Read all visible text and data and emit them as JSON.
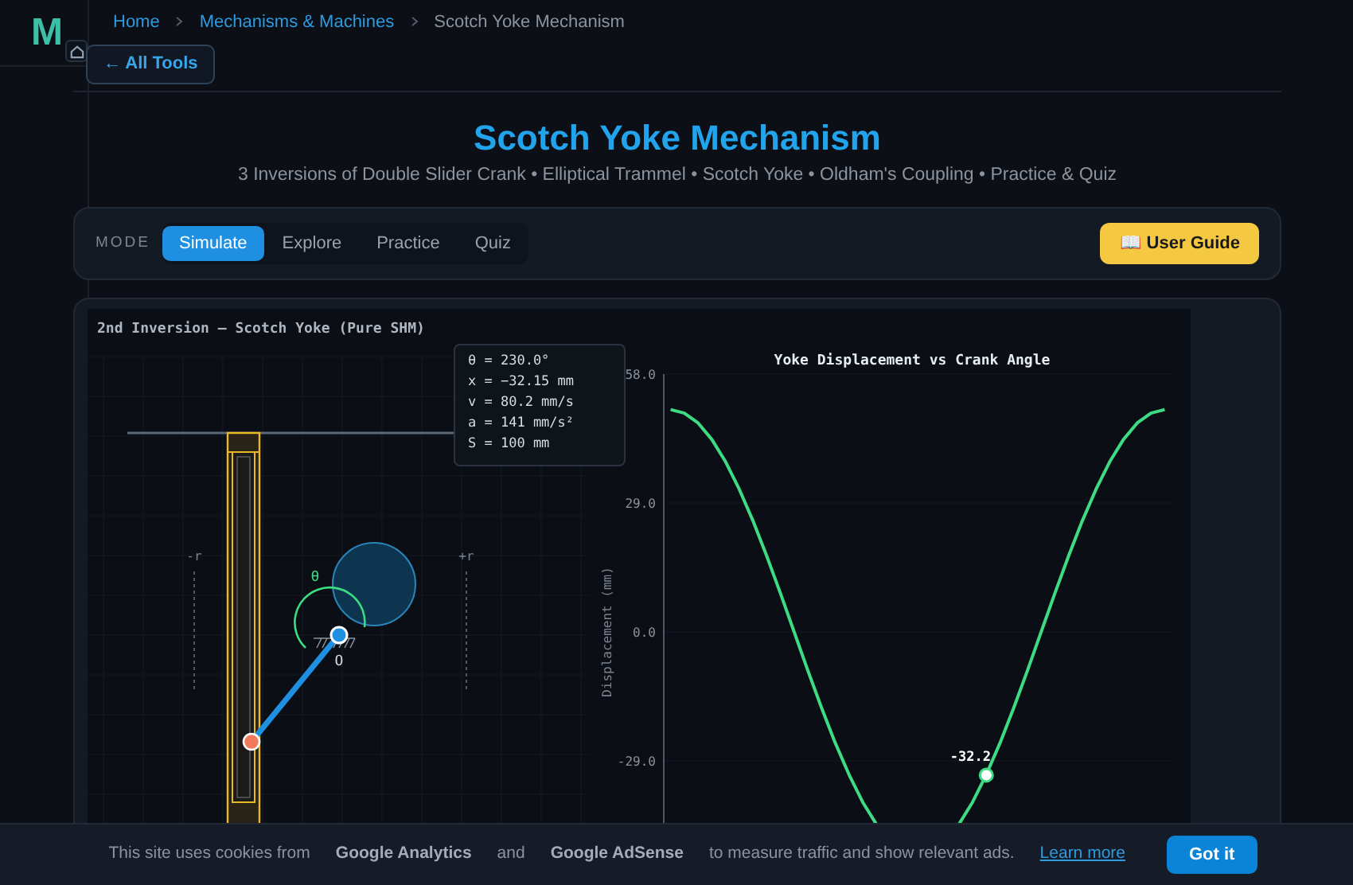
{
  "sidebar": {
    "logo": "M"
  },
  "breadcrumb": [
    {
      "label": "Home",
      "kind": "link"
    },
    {
      "label": "Mechanisms & Machines",
      "kind": "link"
    },
    {
      "label": "Scotch Yoke Mechanism",
      "kind": "current"
    }
  ],
  "back_button": "← All Tools",
  "header": {
    "title": "Scotch Yoke Mechanism",
    "subtitle": "3 Inversions of Double Slider Crank • Elliptical Trammel • Scotch Yoke • Oldham's Coupling • Practice & Quiz"
  },
  "mode_bar": {
    "label": "MODE",
    "tabs": [
      {
        "label": "Simulate",
        "selected": true
      },
      {
        "label": "Explore",
        "selected": false
      },
      {
        "label": "Practice",
        "selected": false
      },
      {
        "label": "Quiz",
        "selected": false
      }
    ],
    "guide_button": "📖 User Guide"
  },
  "simulation": {
    "title": "2nd Inversion — Scotch Yoke (Pure SHM)",
    "angle_label": "θ",
    "pivot_label": "O",
    "limit_labels": [
      "-r",
      "+r"
    ],
    "readout": [
      "θ = 230.0°",
      "x = −32.15 mm",
      "v = 80.2 mm/s",
      "a = 141 mm/s²",
      "S = 100 mm"
    ],
    "marker_label": "-32.2",
    "chart_data": {
      "type": "line",
      "title": "Yoke Displacement vs Crank Angle",
      "ylabel": "Displacement (mm)",
      "categories": [
        null,
        null,
        null,
        null,
        null,
        null,
        null,
        null,
        null,
        null,
        null,
        null,
        null,
        null,
        null,
        null,
        null,
        null,
        null,
        null,
        null,
        null,
        null,
        null,
        null,
        null,
        null,
        null,
        null,
        null,
        null,
        null,
        null,
        null,
        null,
        null,
        null
      ],
      "series": [
        {
          "color": "#3ddc84",
          "values": [
            50,
            49.2,
            47.0,
            43.3,
            38.3,
            32.1,
            25.0,
            17.1,
            8.7,
            0,
            -8.7,
            -17.1,
            -25.0,
            -32.1,
            -38.3,
            -43.3,
            null,
            null,
            null,
            null,
            null,
            -43.3,
            -38.3,
            -32.1,
            -25.0,
            -17.1,
            -8.7,
            0,
            8.7,
            17.1,
            25.0,
            32.1,
            38.3,
            43.3,
            47.0,
            49.2,
            50
          ]
        }
      ],
      "ylim": [
        -58,
        58
      ],
      "grid": true,
      "yticks": [
        {
          "value": 58,
          "label": "58.0"
        },
        {
          "value": 29,
          "label": "29.0"
        },
        {
          "value": 0,
          "label": "0.0"
        },
        {
          "value": -29,
          "label": "-29.0"
        }
      ]
    }
  },
  "cookie_banner": [
    {
      "text": "This site uses cookies from",
      "kind": "text"
    },
    {
      "text": "Google Analytics",
      "kind": "strong"
    },
    {
      "text": "and",
      "kind": "text"
    },
    {
      "text": "Google AdSense",
      "kind": "strong"
    },
    {
      "text": "to measure traffic and show relevant ads.",
      "kind": "text"
    },
    {
      "text": "Learn more",
      "kind": "link"
    },
    {
      "text": "Got it",
      "kind": "button"
    }
  ]
}
